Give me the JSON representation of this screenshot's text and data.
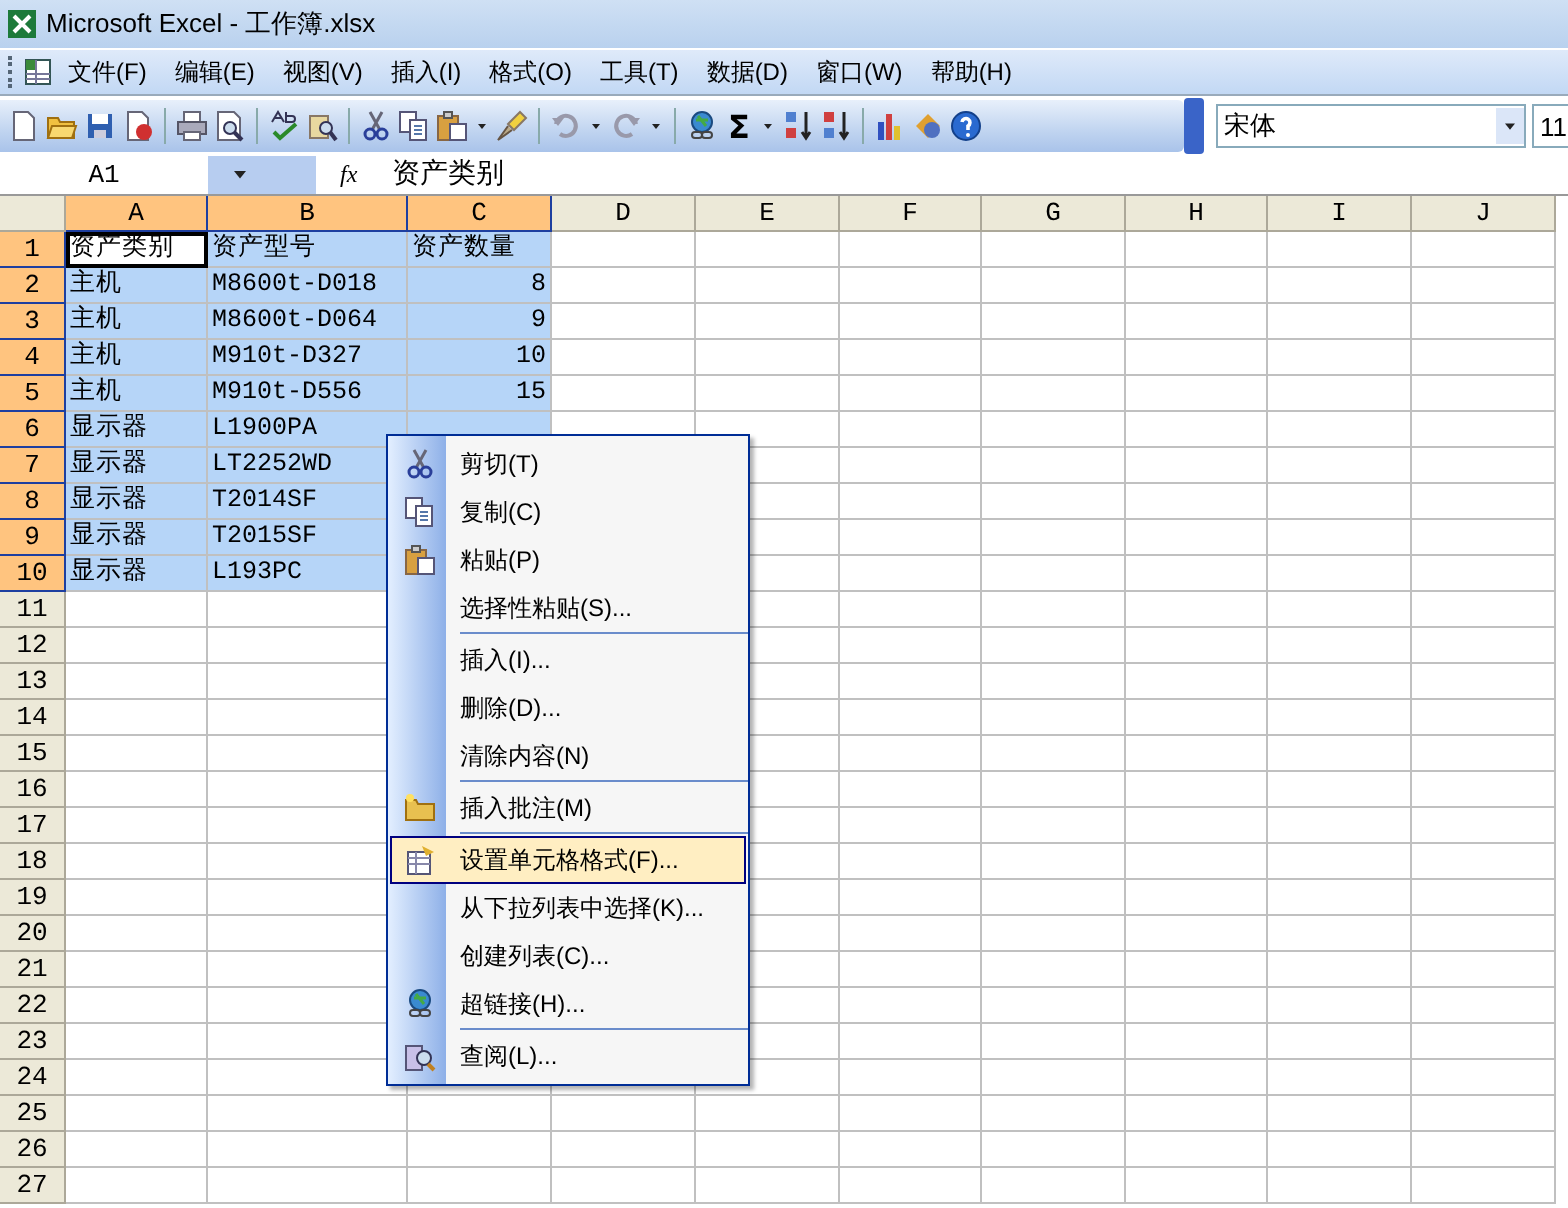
{
  "window": {
    "title": "Microsoft Excel - 工作簿.xlsx"
  },
  "menu_bar": [
    "文件(F)",
    "编辑(E)",
    "视图(V)",
    "插入(I)",
    "格式(O)",
    "工具(T)",
    "数据(D)",
    "窗口(W)",
    "帮助(H)"
  ],
  "toolbar": {
    "sum_symbol": "Σ",
    "font": "宋体",
    "font_size": "11"
  },
  "formula_bar": {
    "name_box": "A1",
    "fx": "fx",
    "formula": "资产类别"
  },
  "sheet": {
    "columns": [
      {
        "label": "A",
        "selected": true
      },
      {
        "label": "B",
        "selected": true
      },
      {
        "label": "C",
        "selected": true
      },
      {
        "label": "D",
        "selected": false
      },
      {
        "label": "E",
        "selected": false
      },
      {
        "label": "F",
        "selected": false
      },
      {
        "label": "G",
        "selected": false
      },
      {
        "label": "H",
        "selected": false
      },
      {
        "label": "I",
        "selected": false
      },
      {
        "label": "J",
        "selected": false
      }
    ],
    "rows": [
      {
        "header": "1",
        "selected": true,
        "cells": [
          {
            "text": "资产类别",
            "kind": "text",
            "active": true
          },
          {
            "text": "资产型号",
            "kind": "text",
            "active": false
          },
          {
            "text": "资产数量",
            "kind": "text",
            "active": false
          }
        ]
      },
      {
        "header": "2",
        "selected": true,
        "cells": [
          {
            "text": "主机",
            "kind": "text",
            "active": false
          },
          {
            "text": "M8600t-D018",
            "kind": "text",
            "active": false
          },
          {
            "text": "8",
            "kind": "number",
            "active": false
          }
        ]
      },
      {
        "header": "3",
        "selected": true,
        "cells": [
          {
            "text": "主机",
            "kind": "text",
            "active": false
          },
          {
            "text": "M8600t-D064",
            "kind": "text",
            "active": false
          },
          {
            "text": "9",
            "kind": "number",
            "active": false
          }
        ]
      },
      {
        "header": "4",
        "selected": true,
        "cells": [
          {
            "text": "主机",
            "kind": "text",
            "active": false
          },
          {
            "text": "M910t-D327",
            "kind": "text",
            "active": false
          },
          {
            "text": "10",
            "kind": "number",
            "active": false
          }
        ]
      },
      {
        "header": "5",
        "selected": true,
        "cells": [
          {
            "text": "主机",
            "kind": "text",
            "active": false
          },
          {
            "text": "M910t-D556",
            "kind": "text",
            "active": false
          },
          {
            "text": "15",
            "kind": "number",
            "active": false
          }
        ]
      },
      {
        "header": "6",
        "selected": true,
        "cells": [
          {
            "text": "显示器",
            "kind": "text",
            "active": false
          },
          {
            "text": "L1900PA",
            "kind": "text",
            "active": false
          }
        ]
      },
      {
        "header": "7",
        "selected": true,
        "cells": [
          {
            "text": "显示器",
            "kind": "text",
            "active": false
          },
          {
            "text": "LT2252WD",
            "kind": "text",
            "active": false
          }
        ]
      },
      {
        "header": "8",
        "selected": true,
        "cells": [
          {
            "text": "显示器",
            "kind": "text",
            "active": false
          },
          {
            "text": "T2014SF",
            "kind": "text",
            "active": false
          }
        ]
      },
      {
        "header": "9",
        "selected": true,
        "cells": [
          {
            "text": "显示器",
            "kind": "text",
            "active": false
          },
          {
            "text": "T2015SF",
            "kind": "text",
            "active": false
          }
        ]
      },
      {
        "header": "10",
        "selected": true,
        "cells": [
          {
            "text": "显示器",
            "kind": "text",
            "active": false
          },
          {
            "text": "L193PC",
            "kind": "text",
            "active": false
          }
        ]
      },
      {
        "header": "11",
        "selected": false,
        "cells": []
      },
      {
        "header": "12",
        "selected": false,
        "cells": []
      },
      {
        "header": "13",
        "selected": false,
        "cells": []
      },
      {
        "header": "14",
        "selected": false,
        "cells": []
      },
      {
        "header": "15",
        "selected": false,
        "cells": []
      },
      {
        "header": "16",
        "selected": false,
        "cells": []
      },
      {
        "header": "17",
        "selected": false,
        "cells": []
      },
      {
        "header": "18",
        "selected": false,
        "cells": []
      },
      {
        "header": "19",
        "selected": false,
        "cells": []
      },
      {
        "header": "20",
        "selected": false,
        "cells": []
      },
      {
        "header": "21",
        "selected": false,
        "cells": []
      },
      {
        "header": "22",
        "selected": false,
        "cells": []
      },
      {
        "header": "23",
        "selected": false,
        "cells": []
      },
      {
        "header": "24",
        "selected": false,
        "cells": []
      },
      {
        "header": "25",
        "selected": false,
        "cells": []
      },
      {
        "header": "26",
        "selected": false,
        "cells": []
      },
      {
        "header": "27",
        "selected": false,
        "cells": []
      }
    ]
  },
  "context_menu": [
    {
      "label": "剪切(T)",
      "selected": false,
      "separator_before": false
    },
    {
      "label": "复制(C)",
      "selected": false,
      "separator_before": false
    },
    {
      "label": "粘贴(P)",
      "selected": false,
      "separator_before": false
    },
    {
      "label": "选择性粘贴(S)...",
      "selected": false,
      "separator_before": false
    },
    {
      "label": "插入(I)...",
      "selected": false,
      "separator_before": true
    },
    {
      "label": "删除(D)...",
      "selected": false,
      "separator_before": false
    },
    {
      "label": "清除内容(N)",
      "selected": false,
      "separator_before": false
    },
    {
      "label": "插入批注(M)",
      "selected": false,
      "separator_before": true
    },
    {
      "label": "设置单元格格式(F)...",
      "selected": true,
      "separator_before": true
    },
    {
      "label": "从下拉列表中选择(K)...",
      "selected": false,
      "separator_before": false
    },
    {
      "label": "创建列表(C)...",
      "selected": false,
      "separator_before": false
    },
    {
      "label": "超链接(H)...",
      "selected": false,
      "separator_before": false
    },
    {
      "label": "查阅(L)...",
      "selected": false,
      "separator_before": true
    }
  ]
}
